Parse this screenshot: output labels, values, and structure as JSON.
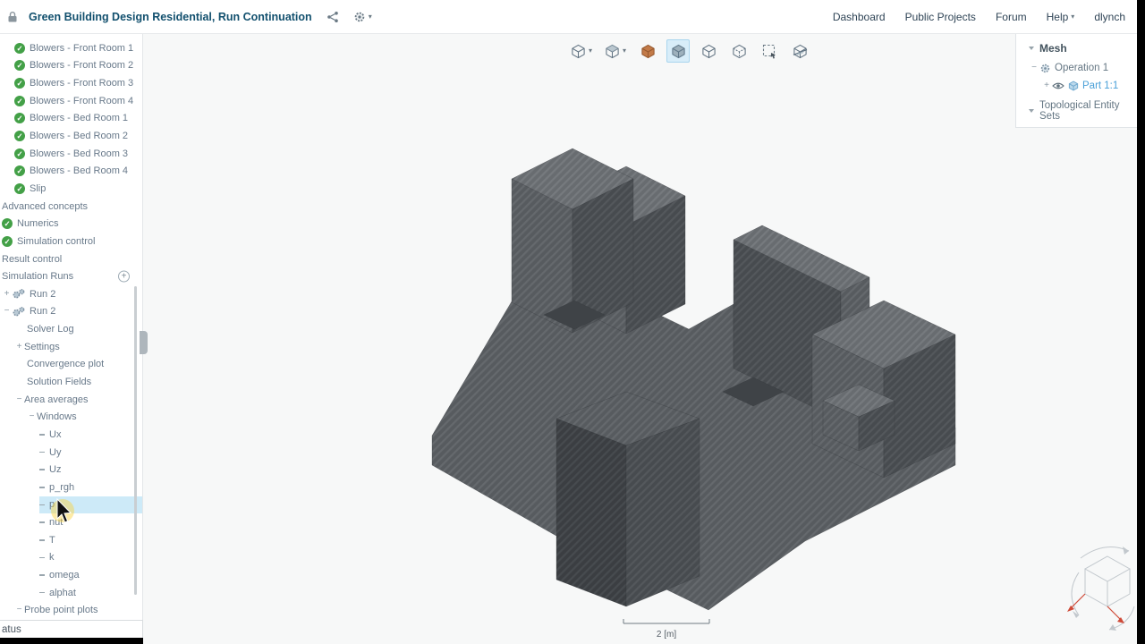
{
  "header": {
    "title": "Green Building Design Residential, Run Continuation",
    "nav": [
      {
        "label": "Dashboard"
      },
      {
        "label": "Public Projects"
      },
      {
        "label": "Forum"
      },
      {
        "label": "Help",
        "caret": true
      },
      {
        "label": "dlynch"
      }
    ]
  },
  "sidebar": {
    "items": [
      {
        "label": "Blowers - Front Room 1",
        "indent": 1,
        "icon": "check"
      },
      {
        "label": "Blowers - Front Room 2",
        "indent": 1,
        "icon": "check"
      },
      {
        "label": "Blowers - Front Room 3",
        "indent": 1,
        "icon": "check"
      },
      {
        "label": "Blowers - Front Room 4",
        "indent": 1,
        "icon": "check"
      },
      {
        "label": "Blowers - Bed Room 1",
        "indent": 1,
        "icon": "check"
      },
      {
        "label": "Blowers - Bed Room 2",
        "indent": 1,
        "icon": "check"
      },
      {
        "label": "Blowers - Bed Room 3",
        "indent": 1,
        "icon": "check"
      },
      {
        "label": "Blowers - Bed Room 4",
        "indent": 1,
        "icon": "check"
      },
      {
        "label": "Slip",
        "indent": 1,
        "icon": "check"
      },
      {
        "label": "Advanced concepts",
        "indent": 0
      },
      {
        "label": "Numerics",
        "indent": 0,
        "icon": "check"
      },
      {
        "label": "Simulation control",
        "indent": 0,
        "icon": "check"
      },
      {
        "label": "Result control",
        "indent": 0
      },
      {
        "label": "Simulation Runs",
        "indent": 0,
        "trailing": "plus-circle"
      },
      {
        "label": "Run 2",
        "indent": 0,
        "expander": "plus",
        "icon": "gears"
      },
      {
        "label": "Run 2",
        "indent": 0,
        "expander": "minus",
        "icon": "gears"
      },
      {
        "label": "Solver Log",
        "indent": 2
      },
      {
        "label": "Settings",
        "indent": 1,
        "expander": "plus"
      },
      {
        "label": "Convergence plot",
        "indent": 2
      },
      {
        "label": "Solution Fields",
        "indent": 2
      },
      {
        "label": "Area averages",
        "indent": 1,
        "expander": "minus"
      },
      {
        "label": "Windows",
        "indent": 2,
        "expander": "minus"
      },
      {
        "label": "Ux",
        "indent": 3,
        "icon": "dash"
      },
      {
        "label": "Uy",
        "indent": 3,
        "icon": "dash"
      },
      {
        "label": "Uz",
        "indent": 3,
        "icon": "dash"
      },
      {
        "label": "p_rgh",
        "indent": 3,
        "icon": "dash"
      },
      {
        "label": "p",
        "indent": 3,
        "icon": "dash",
        "highlighted": true
      },
      {
        "label": "nut",
        "indent": 3,
        "icon": "dash"
      },
      {
        "label": "T",
        "indent": 3,
        "icon": "dash"
      },
      {
        "label": "k",
        "indent": 3,
        "icon": "dash"
      },
      {
        "label": "omega",
        "indent": 3,
        "icon": "dash"
      },
      {
        "label": "alphat",
        "indent": 3,
        "icon": "dash"
      },
      {
        "label": "Probe point plots",
        "indent": 1,
        "expander": "minus"
      }
    ],
    "status": "atus"
  },
  "toolbar": {
    "buttons": [
      {
        "name": "view-orientation",
        "icon": "view-cube",
        "caret": true
      },
      {
        "name": "render-mode",
        "icon": "render-cube",
        "caret": true
      },
      {
        "name": "mesh-quality",
        "icon": "cube-solid-orange"
      },
      {
        "name": "mesh-visibility",
        "icon": "cube-solid",
        "active": true
      },
      {
        "name": "surface-mode",
        "icon": "cube-outline"
      },
      {
        "name": "edge-mode",
        "icon": "cube-edges"
      },
      {
        "name": "box-select",
        "icon": "box-select"
      },
      {
        "name": "mesh-clip",
        "icon": "mesh-clip"
      }
    ]
  },
  "right_panel": {
    "title": "Mesh",
    "operation": "Operation 1",
    "part": "Part 1:1",
    "section": "Topological Entity Sets"
  },
  "viewer": {
    "scale_label": "2 [m]"
  },
  "icons": {
    "check": "✓",
    "expand": "+",
    "collapse": "−",
    "add": "+",
    "caret_down": "▾"
  },
  "colors": {
    "accent_blue": "#4aa0d8",
    "check_green": "#43a047",
    "highlight": "#cdeaf8",
    "title": "#12506e",
    "orange": "#c27a48"
  }
}
